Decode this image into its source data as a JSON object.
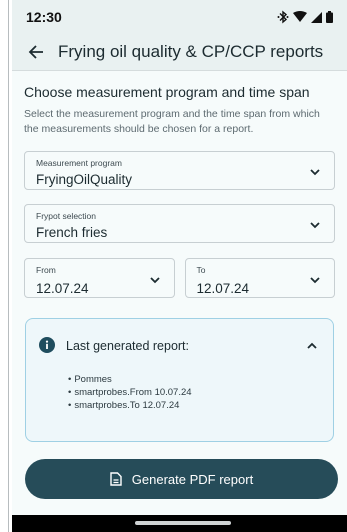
{
  "status_bar": {
    "time": "12:30",
    "icons": [
      "bluetooth-icon",
      "wifi-icon",
      "signal-icon",
      "battery-icon"
    ]
  },
  "app_bar": {
    "back_icon": "arrow-left-icon",
    "title": "Frying oil quality & CP/CCP reports"
  },
  "section": {
    "title": "Choose measurement program and time span",
    "description": "Select the measurement program and the time span from which the measurements should be chosen for a report."
  },
  "measurement_program": {
    "label": "Measurement program",
    "value": "FryingOilQuality"
  },
  "frypot_selection": {
    "label": "Frypot selection",
    "value": "French fries"
  },
  "date_from": {
    "label": "From",
    "value": "12.07.24"
  },
  "date_to": {
    "label": "To",
    "value": "12.07.24"
  },
  "last_report": {
    "title": "Last generated report:",
    "items": [
      "Pommes",
      "smartprobes.From 10.07.24",
      "smartprobes.To 12.07.24"
    ]
  },
  "generate_button": {
    "label": "Generate PDF report",
    "icon": "document-icon"
  },
  "colors": {
    "primary": "#264c59",
    "background": "#f6fbfb",
    "card_border": "#9fd0e4",
    "info": "#1f4d5e"
  }
}
